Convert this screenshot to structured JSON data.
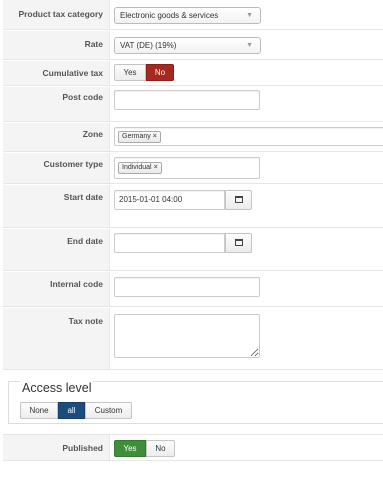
{
  "form": {
    "product_tax_category": {
      "label": "Product tax category",
      "value": "Electronic goods & services"
    },
    "rate": {
      "label": "Rate",
      "value": "VAT (DE) (19%)"
    },
    "cumulative_tax": {
      "label": "Cumulative tax",
      "yes": "Yes",
      "no": "No",
      "selected": "No"
    },
    "post_code": {
      "label": "Post code",
      "value": ""
    },
    "zone": {
      "label": "Zone",
      "tags": [
        "Germany"
      ]
    },
    "customer_type": {
      "label": "Customer type",
      "tags": [
        "Individual"
      ]
    },
    "start_date": {
      "label": "Start date",
      "value": "2015-01-01 04:00"
    },
    "end_date": {
      "label": "End date",
      "value": ""
    },
    "internal_code": {
      "label": "Internal code",
      "value": ""
    },
    "tax_note": {
      "label": "Tax note",
      "value": ""
    },
    "access_level": {
      "legend": "Access level",
      "options": [
        "None",
        "all",
        "Custom"
      ],
      "selected": "all"
    },
    "published": {
      "label": "Published",
      "yes": "Yes",
      "no": "No",
      "selected": "Yes"
    }
  },
  "icons": {
    "tag_remove": "×",
    "caret": "▼",
    "calendar": "calendar-icon"
  },
  "colors": {
    "no_active": "#a7281f",
    "yes_active": "#3f8f3a",
    "access_active": "#1c4b7e"
  }
}
